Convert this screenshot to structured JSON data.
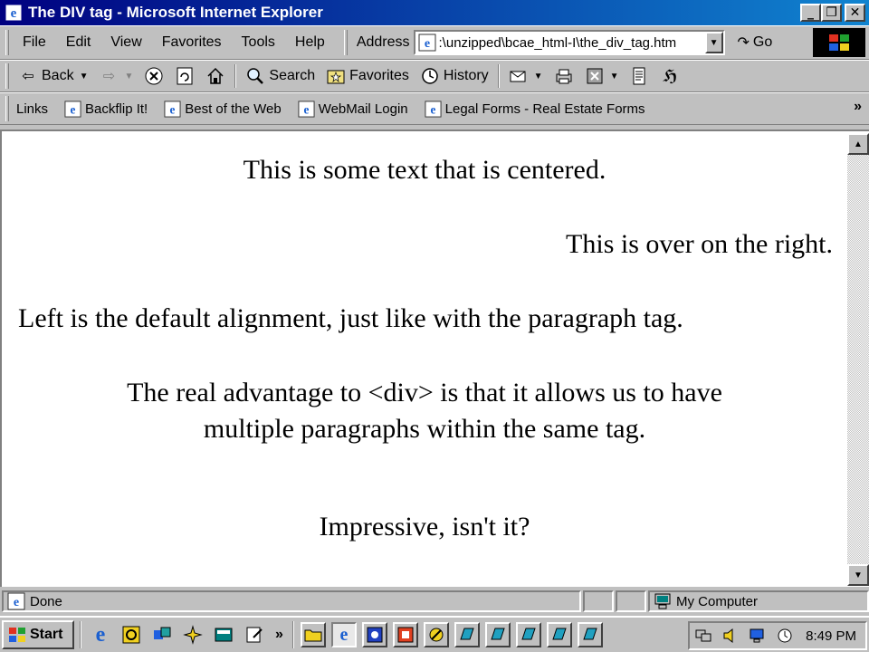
{
  "window": {
    "title": "The DIV tag - Microsoft Internet Explorer"
  },
  "menubar": {
    "items": [
      "File",
      "Edit",
      "View",
      "Favorites",
      "Tools",
      "Help"
    ],
    "address_label": "Address",
    "address_value": ":\\unzipped\\bcae_html-I\\the_div_tag.htm",
    "go_label": "Go"
  },
  "toolbar": {
    "back_label": "Back",
    "search_label": "Search",
    "favorites_label": "Favorites",
    "history_label": "History"
  },
  "links": {
    "label": "Links",
    "items": [
      "Backflip It!",
      "Best of the Web",
      "WebMail Login",
      "Legal Forms - Real Estate Forms"
    ],
    "overflow": "»"
  },
  "page": {
    "line1": "This is some text that is centered.",
    "line2": "This is over on the right.",
    "line3": "Left is the default alignment, just like with the paragraph tag.",
    "line4a": "The real advantage to <div> is that it allows us to have",
    "line4b": "multiple paragraphs within the same tag.",
    "line5": "Impressive, isn't it?"
  },
  "statusbar": {
    "status": "Done",
    "zone": "My Computer"
  },
  "taskbar": {
    "start_label": "Start",
    "overflow": "»",
    "clock": "8:49 PM"
  },
  "colors": {
    "titlebar_start": "#000080",
    "titlebar_end": "#1084d0",
    "chrome": "#c0c0c0"
  }
}
